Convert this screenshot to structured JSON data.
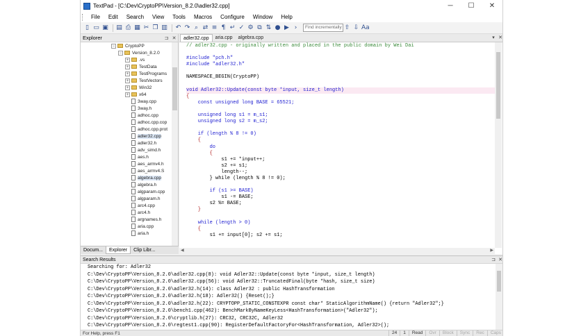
{
  "window": {
    "title": "TextPad - [C:\\Dev\\CryptoPP\\Version_8.2.0\\adler32.cpp]",
    "minimize": "─",
    "maximize": "☐",
    "close": "✕"
  },
  "menu": [
    "File",
    "Edit",
    "Search",
    "View",
    "Tools",
    "Macros",
    "Configure",
    "Window",
    "Help"
  ],
  "toolbar": {
    "find_placeholder": "Find incrementally",
    "buttons": [
      "new-file-icon",
      "open-file-icon",
      "save-icon",
      "save-all-icon",
      "print-icon",
      "print-preview-icon",
      "cut-icon",
      "copy-icon",
      "paste-icon",
      "undo-icon",
      "redo-icon",
      "find-icon",
      "replace-icon",
      "spell-icon",
      "tools-icon",
      "record-icon",
      "play-icon",
      "next-icon",
      "find-up-icon",
      "find-down-icon",
      "match-case-icon"
    ]
  },
  "explorer": {
    "title": "Explorer",
    "pin": "⊐",
    "close": "✕",
    "tree": [
      {
        "label": "CryptoPP",
        "type": "folder",
        "expander": "−",
        "indent": 0
      },
      {
        "label": "Version_8.2.0",
        "type": "folder",
        "expander": "−",
        "indent": 1
      },
      {
        "label": ".vs",
        "type": "folder",
        "expander": "+",
        "indent": 2
      },
      {
        "label": "TestData",
        "type": "folder",
        "expander": "+",
        "indent": 2
      },
      {
        "label": "TestPrograms",
        "type": "folder",
        "expander": "+",
        "indent": 2
      },
      {
        "label": "TestVectors",
        "type": "folder",
        "expander": "+",
        "indent": 2
      },
      {
        "label": "Win32",
        "type": "folder",
        "expander": "+",
        "indent": 2
      },
      {
        "label": "x64",
        "type": "folder",
        "expander": "+",
        "indent": 2
      },
      {
        "label": "3way.cpp",
        "type": "file",
        "expander": "",
        "indent": 2
      },
      {
        "label": "3way.h",
        "type": "file",
        "expander": "",
        "indent": 2
      },
      {
        "label": "adhoc.cpp",
        "type": "file",
        "expander": "",
        "indent": 2
      },
      {
        "label": "adhoc.cpp.cop",
        "type": "file",
        "expander": "",
        "indent": 2
      },
      {
        "label": "adhoc.cpp.prot",
        "type": "file",
        "expander": "",
        "indent": 2
      },
      {
        "label": "adler32.cpp",
        "type": "file",
        "expander": "",
        "indent": 2,
        "highlight": true
      },
      {
        "label": "adler32.h",
        "type": "file",
        "expander": "",
        "indent": 2
      },
      {
        "label": "adv_simd.h",
        "type": "file",
        "expander": "",
        "indent": 2
      },
      {
        "label": "aes.h",
        "type": "file",
        "expander": "",
        "indent": 2
      },
      {
        "label": "aes_armv4.h",
        "type": "file",
        "expander": "",
        "indent": 2
      },
      {
        "label": "aes_armv4.S",
        "type": "file",
        "expander": "",
        "indent": 2
      },
      {
        "label": "algebra.cpp",
        "type": "file",
        "expander": "",
        "indent": 2,
        "highlight": true
      },
      {
        "label": "algebra.h",
        "type": "file",
        "expander": "",
        "indent": 2
      },
      {
        "label": "algparam.cpp",
        "type": "file",
        "expander": "",
        "indent": 2
      },
      {
        "label": "algparam.h",
        "type": "file",
        "expander": "",
        "indent": 2
      },
      {
        "label": "arc4.cpp",
        "type": "file",
        "expander": "",
        "indent": 2
      },
      {
        "label": "arc4.h",
        "type": "file",
        "expander": "",
        "indent": 2
      },
      {
        "label": "argnames.h",
        "type": "file",
        "expander": "",
        "indent": 2
      },
      {
        "label": "aria.cpp",
        "type": "file",
        "expander": "",
        "indent": 2
      },
      {
        "label": "aria.h",
        "type": "file",
        "expander": "",
        "indent": 2
      }
    ],
    "bottom_tabs": [
      {
        "label": "Docum...",
        "active": false
      },
      {
        "label": "Explorer",
        "active": true
      },
      {
        "label": "Clip Libr...",
        "active": false
      }
    ]
  },
  "editor": {
    "tabs": [
      {
        "label": "adler32.cpp",
        "active": true
      },
      {
        "label": "aria.cpp",
        "active": false
      },
      {
        "label": "algebra.cpp",
        "active": false
      }
    ],
    "lines": [
      {
        "text": "// adler32.cpp - originally written and placed in the public domain by Wei Dai",
        "cls": "cmt"
      },
      {
        "text": "",
        "cls": ""
      },
      {
        "text": "#include \"pch.h\"",
        "cls": "pre"
      },
      {
        "text": "#include \"adler32.h\"",
        "cls": "pre"
      },
      {
        "text": "",
        "cls": ""
      },
      {
        "text": "NAMESPACE_BEGIN(CryptoPP)",
        "cls": ""
      },
      {
        "text": "",
        "cls": ""
      },
      {
        "text": "void Adler32::Update(const byte *input, size_t length)",
        "cls": "kw",
        "current": true
      },
      {
        "text": "{",
        "cls": "br"
      },
      {
        "text": "    const unsigned long BASE = 65521;",
        "cls": "kw"
      },
      {
        "text": "",
        "cls": ""
      },
      {
        "text": "    unsigned long s1 = m_s1;",
        "cls": "kw"
      },
      {
        "text": "    unsigned long s2 = m_s2;",
        "cls": "kw"
      },
      {
        "text": "",
        "cls": ""
      },
      {
        "text": "    if (length % 8 != 0)",
        "cls": "kw"
      },
      {
        "text": "    {",
        "cls": "br"
      },
      {
        "text": "        do",
        "cls": "kw"
      },
      {
        "text": "        {",
        "cls": "br"
      },
      {
        "text": "            s1 += *input++;",
        "cls": ""
      },
      {
        "text": "            s2 += s1;",
        "cls": ""
      },
      {
        "text": "            length--;",
        "cls": ""
      },
      {
        "text": "        } while (length % 8 != 0);",
        "cls": ""
      },
      {
        "text": "",
        "cls": ""
      },
      {
        "text": "        if (s1 >= BASE)",
        "cls": "kw"
      },
      {
        "text": "            s1 -= BASE;",
        "cls": ""
      },
      {
        "text": "        s2 %= BASE;",
        "cls": ""
      },
      {
        "text": "    }",
        "cls": "br"
      },
      {
        "text": "",
        "cls": ""
      },
      {
        "text": "    while (length > 0)",
        "cls": "kw"
      },
      {
        "text": "    {",
        "cls": "br"
      },
      {
        "text": "        s1 += input[0]; s2 += s1;",
        "cls": ""
      }
    ]
  },
  "results": {
    "title": "Search Results",
    "lines": [
      "Searching for: Adler32",
      "C:\\Dev\\CryptoPP\\Version_8.2.0\\adler32.cpp(8): void Adler32::Update(const byte *input, size_t length)",
      "C:\\Dev\\CryptoPP\\Version_8.2.0\\adler32.cpp(56): void Adler32::TruncatedFinal(byte *hash, size_t size)",
      "C:\\Dev\\CryptoPP\\Version_8.2.0\\adler32.h(14): class Adler32 : public HashTransformation",
      "C:\\Dev\\CryptoPP\\Version_8.2.0\\adler32.h(18): Adler32() {Reset();}",
      "C:\\Dev\\CryptoPP\\Version_8.2.0\\adler32.h(22): CRYPTOPP_STATIC_CONSTEXPR const char* StaticAlgorithmName() {return \"Adler32\";}",
      "C:\\Dev\\CryptoPP\\Version_8.2.0\\bench1.cpp(462): BenchMarkByNameKeyLess<HashTransformation>(\"Adler32\");",
      "C:\\Dev\\CryptoPP\\Version_8.2.0\\cryptlib.h(27): CRC32, CRC32C, Adler32",
      "C:\\Dev\\CryptoPP\\Version_8.2.0\\regtest1.cpp(90): RegisterDefaultFactoryFor<HashTransformation, Adler32>();"
    ]
  },
  "status": {
    "help": "For Help, press F1",
    "col": "24",
    "line": "1",
    "read": "Read",
    "ovr": "Ovr",
    "block": "Block",
    "sync": "Sync",
    "rec": "Rec",
    "caps": "Caps"
  },
  "colors": {
    "comment": "#3a8a3a",
    "keyword": "#1c1cd0",
    "string": "#b01c1c",
    "current_line": "#fbe9f2"
  }
}
